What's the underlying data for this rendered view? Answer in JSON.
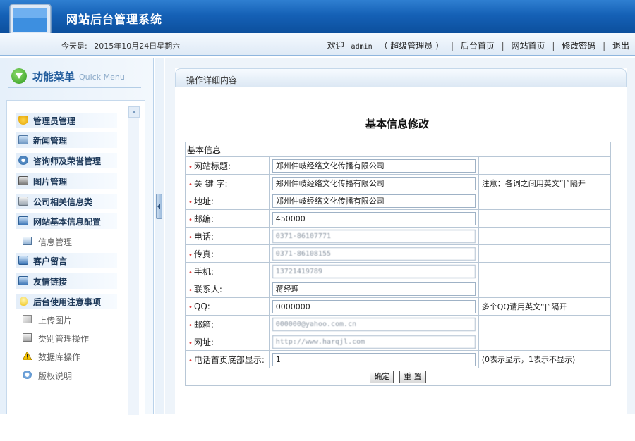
{
  "header": {
    "title": "网站后台管理系统",
    "today_label": "今天是:",
    "today_value": "2015年10月24日星期六",
    "welcome": "欢迎",
    "username": "admin",
    "role": "（ 超级管理员 ）",
    "links": [
      "后台首页",
      "网站首页",
      "修改密码",
      "退出"
    ],
    "separator": "|"
  },
  "sidebar": {
    "title": "功能菜单",
    "title_en": "Quick Menu",
    "items": [
      {
        "label": "管理员管理",
        "icon": "shield-icon"
      },
      {
        "label": "新闻管理",
        "icon": "news-icon"
      },
      {
        "label": "咨询师及荣誉管理",
        "icon": "gear-icon"
      },
      {
        "label": "图片管理",
        "icon": "picture-icon"
      },
      {
        "label": "公司相关信息类",
        "icon": "folder-icon"
      },
      {
        "label": "网站基本信息配置",
        "icon": "monitor-icon"
      },
      {
        "label": "客户留言",
        "icon": "monitor-icon"
      },
      {
        "label": "友情链接",
        "icon": "monitor-icon"
      },
      {
        "label": "后台使用注意事项",
        "icon": "bulb-icon"
      }
    ],
    "config_sub": {
      "label": "信息管理",
      "icon": "document-icon"
    },
    "notes_sub": [
      {
        "label": "上传图片",
        "icon": "edit-icon"
      },
      {
        "label": "类别管理操作",
        "icon": "printer-icon"
      },
      {
        "label": "数据库操作",
        "icon": "warning-icon"
      },
      {
        "label": "版权说明",
        "icon": "info-icon"
      }
    ]
  },
  "main": {
    "breadcrumb": "操作详细内容",
    "page_title": "基本信息修改",
    "section_title": "基本信息",
    "fields": [
      {
        "label": "网站标题:",
        "value": "郑州仲岐经络文化传播有限公司",
        "note": ""
      },
      {
        "label": "关 键 字:",
        "value": "郑州仲岐经络文化传播有限公司",
        "note": "注意：各词之间用英文“|”隔开"
      },
      {
        "label": "地址:",
        "value": "郑州仲岐经络文化传播有限公司",
        "note": ""
      },
      {
        "label": "邮编:",
        "value": "450000",
        "note": ""
      },
      {
        "label": "电话:",
        "value": "0371-86107771",
        "note": ""
      },
      {
        "label": "传真:",
        "value": "0371-86108155",
        "note": ""
      },
      {
        "label": "手机:",
        "value": "13721419789",
        "note": ""
      },
      {
        "label": "联系人:",
        "value": "蒋经理",
        "note": ""
      },
      {
        "label": "QQ:",
        "value": "0000000",
        "note": "多个QQ请用英文“|”隔开"
      },
      {
        "label": "邮箱:",
        "value": "000000@yahoo.com.cn",
        "note": ""
      },
      {
        "label": "网址:",
        "value": "http://www.harqjl.com",
        "note": ""
      },
      {
        "label": "电话首页底部显示:",
        "value": "1",
        "note": "(0表示显示，1表示不显示)"
      }
    ],
    "submit_label": "确定",
    "reset_label": "重 置"
  }
}
